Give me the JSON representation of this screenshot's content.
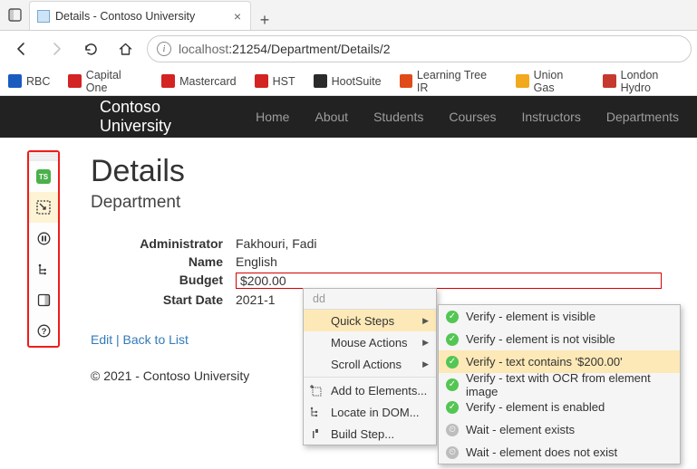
{
  "browser": {
    "tab_title": "Details - Contoso University",
    "url_host": "localhost",
    "url_port_path": ":21254/Department/Details/2",
    "bookmarks": [
      "RBC",
      "Capital One",
      "Mastercard",
      "HST",
      "HootSuite",
      "Learning Tree IR",
      "Union Gas",
      "London Hydro"
    ],
    "bookmark_colors": [
      "#1a5bbf",
      "#d32323",
      "#d32323",
      "#d32323",
      "#2b2b2b",
      "#e04b1a",
      "#f2a91e",
      "#c6392e"
    ]
  },
  "nav": {
    "brand": "Contoso University",
    "items": [
      "Home",
      "About",
      "Students",
      "Courses",
      "Instructors",
      "Departments"
    ]
  },
  "page": {
    "heading": "Details",
    "subheading": "Department",
    "fields": {
      "admin_label": "Administrator",
      "admin_value": "Fakhouri, Fadi",
      "name_label": "Name",
      "name_value": "English",
      "budget_label": "Budget",
      "budget_value": "$200.00",
      "start_label": "Start Date",
      "start_value": "2021-1"
    },
    "edit_link": "Edit",
    "back_link": "Back to List",
    "footer": "© 2021 - Contoso University"
  },
  "side_toolbar": {
    "ts_label": "TS"
  },
  "ctx1": {
    "header": "dd",
    "quick_steps": "Quick Steps",
    "mouse_actions": "Mouse Actions",
    "scroll_actions": "Scroll Actions",
    "add_to_elements": "Add to Elements...",
    "locate_in_dom": "Locate in DOM...",
    "build_step": "Build Step..."
  },
  "ctx2": {
    "visible": "Verify - element is visible",
    "not_visible": "Verify - element is not visible",
    "text_contains": "Verify - text contains '$200.00'",
    "ocr": "Verify - text with OCR from element image",
    "enabled": "Verify - element is enabled",
    "exists": "Wait - element exists",
    "not_exist": "Wait - element does not exist"
  }
}
